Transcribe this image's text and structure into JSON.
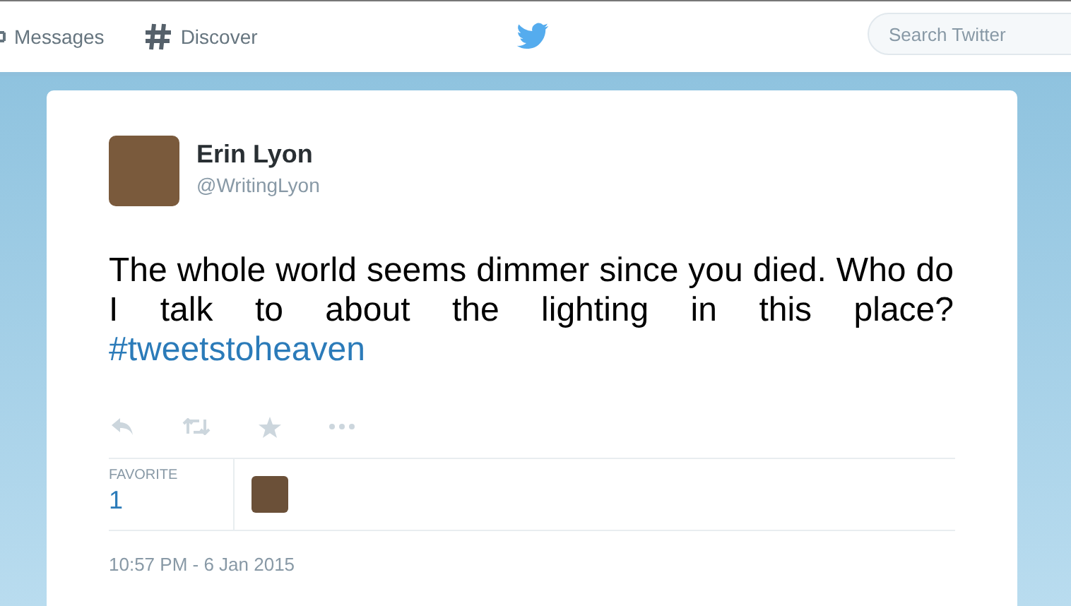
{
  "nav": {
    "items": [
      {
        "label": "Messages",
        "kind": "messages"
      },
      {
        "label": "Discover",
        "kind": "discover"
      }
    ],
    "search": {
      "placeholder": "Search Twitter"
    }
  },
  "tweet": {
    "name": "Erin Lyon",
    "handle": "@WritingLyon",
    "text": "The whole world seems dimmer since you died. Who do I talk to about the lighting in this place?",
    "hashtag": "#tweetstoheaven",
    "stats": [
      {
        "label": "FAVORITE",
        "value": "1"
      }
    ],
    "timestamp": "10:57 PM - 6 Jan 2015"
  }
}
